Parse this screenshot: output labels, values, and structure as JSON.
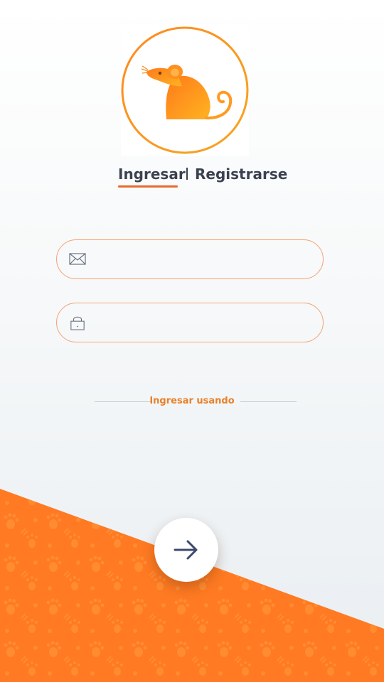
{
  "header": {
    "logo_icon": "mouse-logo-icon"
  },
  "tabs": {
    "login_label": "Ingresar",
    "register_label": "Registrarse",
    "active": "login"
  },
  "form": {
    "email": {
      "icon": "envelope-icon",
      "value": "",
      "placeholder": ""
    },
    "password": {
      "icon": "lock-icon",
      "value": "",
      "placeholder": ""
    }
  },
  "social": {
    "label": "Ingresar usando"
  },
  "submit": {
    "icon": "arrow-right-icon"
  },
  "colors": {
    "accent": "#e8692b",
    "orange_bg": "#ff7a22",
    "text_dark": "#3b4150"
  }
}
